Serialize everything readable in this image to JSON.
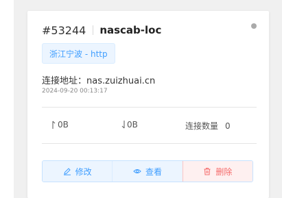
{
  "node": {
    "id": "#53244",
    "name": "nascab-loc",
    "location": "浙江宁波 - http",
    "address_label": "连接地址：",
    "address": "nas.zuizhuai.cn",
    "timestamp": "2024-09-20 00:13:17",
    "status_color": "#aaaaaa"
  },
  "stats": {
    "upload": "0B",
    "download": "0B",
    "connections_label": "连接数量",
    "connections": "0"
  },
  "actions": {
    "edit_label": "修改",
    "view_label": "查看",
    "delete_label": "删除"
  },
  "icons": {
    "upload": "arrow-up-icon",
    "download": "arrow-down-icon",
    "edit": "edit-icon",
    "view": "eye-icon",
    "delete": "trash-icon"
  }
}
